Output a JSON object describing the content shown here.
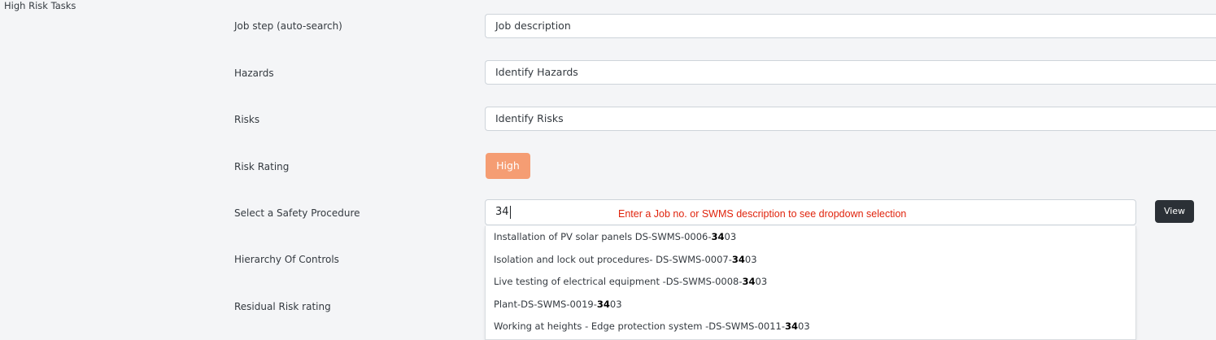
{
  "section": {
    "title": "High Risk Tasks"
  },
  "fields": {
    "job_step": {
      "label": "Job step (auto-search)",
      "value": "Job description"
    },
    "hazards": {
      "label": "Hazards",
      "value": "Identify Hazards"
    },
    "risks": {
      "label": "Risks",
      "value": "Identify Risks"
    },
    "risk_rating": {
      "label": "Risk Rating",
      "value": "High",
      "color": "#f59d73"
    },
    "safety_procedure": {
      "label": "Select a Safety Procedure",
      "value": "34",
      "hint": "Enter a Job no. or SWMS description to see dropdown selection",
      "hint_color": "#e0240d",
      "view_label": "View"
    },
    "hierarchy": {
      "label": "Hierarchy Of Controls"
    },
    "residual": {
      "label": "Residual Risk rating"
    }
  },
  "dropdown": {
    "match": "34",
    "items": [
      {
        "before": "Installation of PV solar panels DS-SWMS-0006-",
        "match": "34",
        "after": "03"
      },
      {
        "before": "Isolation and lock out procedures- DS-SWMS-0007-",
        "match": "34",
        "after": "03"
      },
      {
        "before": "Live testing of electrical equipment -DS-SWMS-0008-",
        "match": "34",
        "after": "03"
      },
      {
        "before": "Plant-DS-SWMS-0019-",
        "match": "34",
        "after": "03"
      },
      {
        "before": "Working at heights - Edge protection system -DS-SWMS-0011-",
        "match": "34",
        "after": "03"
      }
    ]
  }
}
